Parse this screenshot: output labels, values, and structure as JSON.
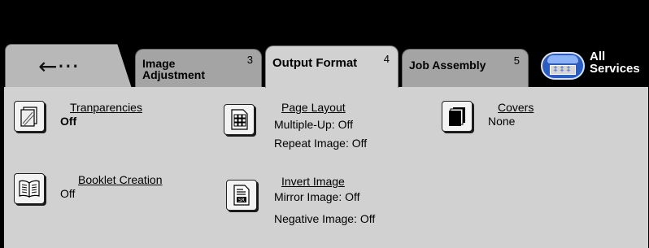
{
  "tabs": [
    {
      "label": "Image\nAdjustment",
      "number": "3"
    },
    {
      "label": "Output Format",
      "number": "4"
    },
    {
      "label": "Job Assembly",
      "number": "5"
    }
  ],
  "back_tab": {
    "label": "←···"
  },
  "all_services": {
    "line1": "All",
    "line2": "Services"
  },
  "features": {
    "transparencies": {
      "title": "Tranparencies",
      "value": "Off",
      "icon": "transparencies-icon"
    },
    "page_layout": {
      "title": "Page Layout",
      "value1": "Multiple-Up: Off",
      "value2": "Repeat Image: Off",
      "icon": "page-layout-icon"
    },
    "covers": {
      "title": "Covers",
      "value": "None",
      "icon": "covers-icon"
    },
    "booklet": {
      "title": "Booklet Creation",
      "value": "Off",
      "icon": "booklet-icon"
    },
    "invert": {
      "title": "Invert Image",
      "value1": "Mirror Image: Off",
      "value2": "Negative Image: Off",
      "icon": "invert-image-icon"
    }
  }
}
